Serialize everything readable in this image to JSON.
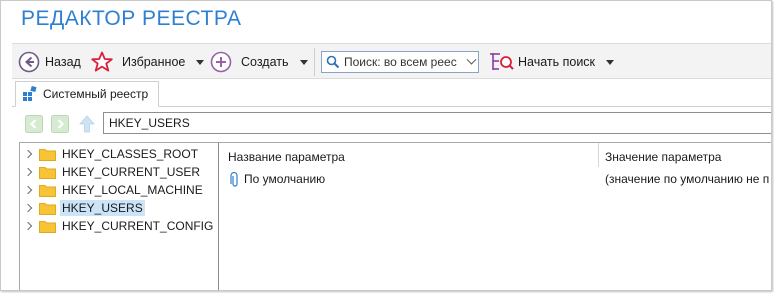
{
  "app": {
    "title": "РЕДАКТОР РЕЕСТРА"
  },
  "toolbar": {
    "back_label": "Назад",
    "favorites_label": "Избранное",
    "create_label": "Создать",
    "search_value": "Поиск: во всем реес",
    "start_search_label": "Начать поиск"
  },
  "tabs": [
    {
      "label": "Системный реестр"
    }
  ],
  "address": {
    "path": "HKEY_USERS"
  },
  "tree": {
    "items": [
      {
        "label": "HKEY_CLASSES_ROOT"
      },
      {
        "label": "HKEY_CURRENT_USER"
      },
      {
        "label": "HKEY_LOCAL_MACHINE"
      },
      {
        "label": "HKEY_USERS",
        "selected": true
      },
      {
        "label": "HKEY_CURRENT_CONFIG"
      }
    ]
  },
  "list": {
    "columns": [
      "Название параметра",
      "Значение параметра"
    ],
    "rows": [
      {
        "name": "По умолчанию",
        "value": "(значение по умолчанию не п"
      }
    ]
  },
  "colors": {
    "title": "#2f7fd0",
    "selection": "#cce4f7",
    "folder": "#f7c436"
  }
}
